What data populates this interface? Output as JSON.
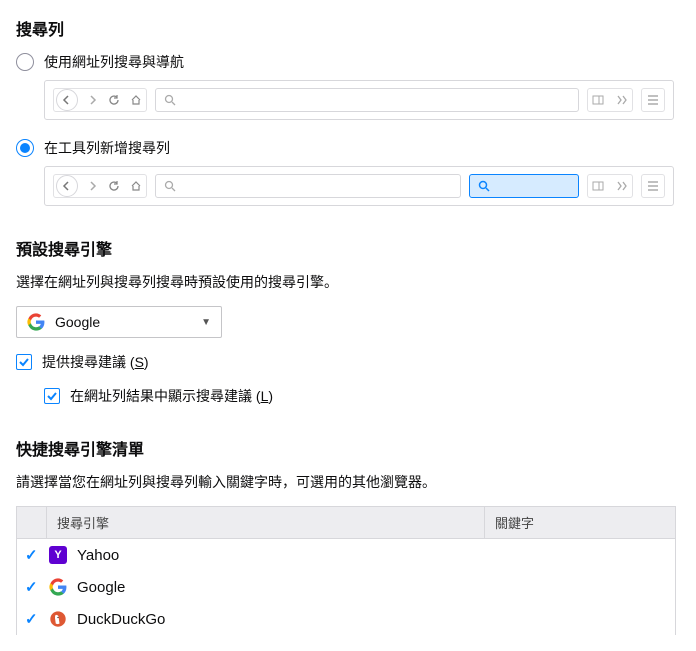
{
  "searchBar": {
    "heading": "搜尋列",
    "option1Label": "使用網址列搜尋與導航",
    "option2Label": "在工具列新增搜尋列",
    "selected": "option2"
  },
  "defaultEngine": {
    "heading": "預設搜尋引擎",
    "description": "選擇在網址列與搜尋列搜尋時預設使用的搜尋引擎。",
    "selectedEngine": "Google"
  },
  "suggestions": {
    "provideLabel": "提供搜尋建議 (",
    "provideKey": "S",
    "provideLabelEnd": ")",
    "provideChecked": true,
    "urlbarLabel": "在網址列結果中顯示搜尋建議 (",
    "urlbarKey": "L",
    "urlbarLabelEnd": ")",
    "urlbarChecked": true
  },
  "oneClick": {
    "heading": "快捷搜尋引擎清單",
    "description": "請選擇當您在網址列與搜尋列輸入關鍵字時，可選用的其他瀏覽器。",
    "headerEngine": "搜尋引擎",
    "headerKeyword": "關鍵字",
    "engines": [
      {
        "name": "Yahoo",
        "checked": true,
        "icon": "yahoo"
      },
      {
        "name": "Google",
        "checked": true,
        "icon": "google"
      },
      {
        "name": "DuckDuckGo",
        "checked": true,
        "icon": "ddg"
      }
    ]
  }
}
